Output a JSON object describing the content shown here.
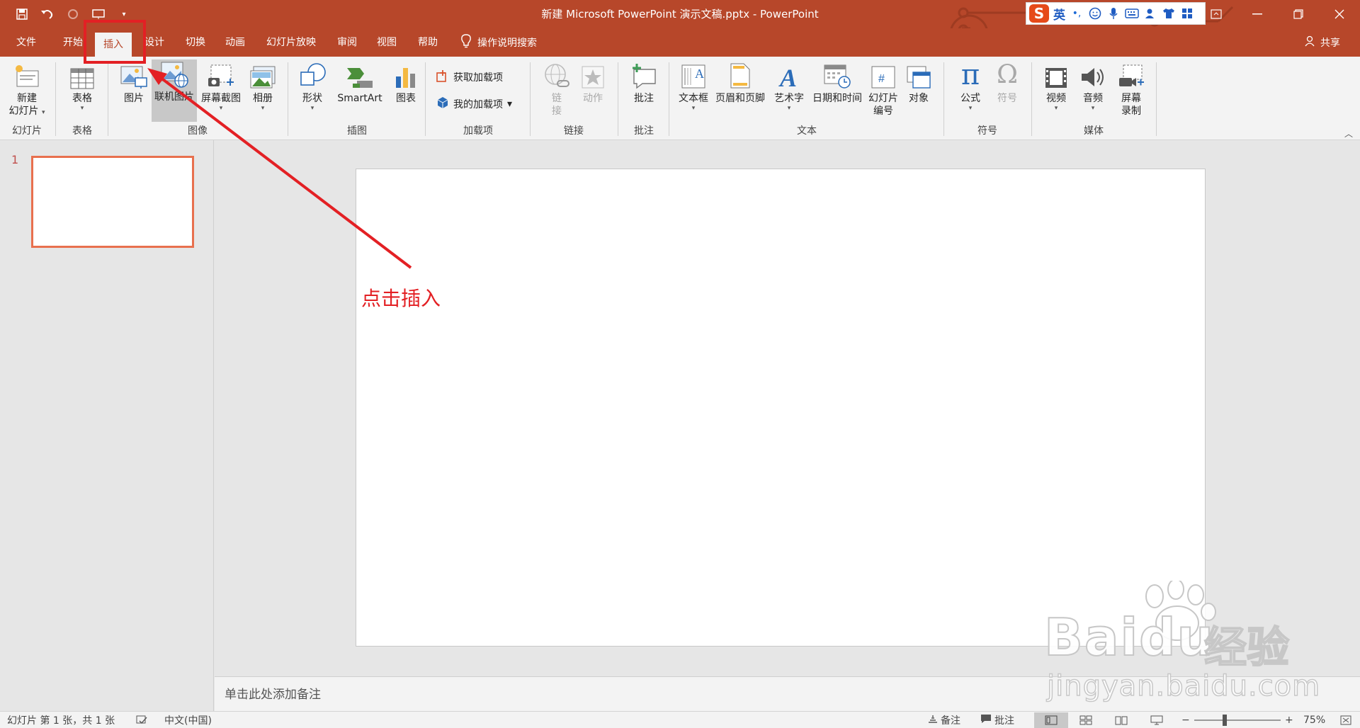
{
  "window": {
    "title": "新建 Microsoft PowerPoint 演示文稿.pptx  -  PowerPoint",
    "accent_color": "#b7472a"
  },
  "ime": {
    "language": "英",
    "punct": "•,"
  },
  "tabs": [
    {
      "label": "文件"
    },
    {
      "label": "开始"
    },
    {
      "label": "插入",
      "active": true
    },
    {
      "label": "设计"
    },
    {
      "label": "切换"
    },
    {
      "label": "动画"
    },
    {
      "label": "幻灯片放映"
    },
    {
      "label": "审阅"
    },
    {
      "label": "视图"
    },
    {
      "label": "帮助"
    }
  ],
  "tell_me": "操作说明搜索",
  "share": "共享",
  "ribbon": {
    "groups": {
      "slides": "幻灯片",
      "tables": "表格",
      "images": "图像",
      "illustrations": "插图",
      "addins": "加载项",
      "links": "链接",
      "comments": "批注",
      "text": "文本",
      "symbols": "符号",
      "media": "媒体"
    },
    "buttons": {
      "new_slide_1": "新建",
      "new_slide_2": "幻灯片",
      "table": "表格",
      "pictures": "图片",
      "online_pictures": "联机图片",
      "screenshot": "屏幕截图",
      "album": "相册",
      "shapes": "形状",
      "smartart": "SmartArt",
      "chart": "图表",
      "get_addins": "获取加载项",
      "my_addins": "我的加载项",
      "link_1": "链",
      "link_2": "接",
      "action": "动作",
      "comment": "批注",
      "textbox": "文本框",
      "header_footer": "页眉和页脚",
      "wordart": "艺术字",
      "datetime": "日期和时间",
      "slide_num_1": "幻灯片",
      "slide_num_2": "编号",
      "object": "对象",
      "equation": "公式",
      "symbol": "符号",
      "video": "视频",
      "audio": "音频",
      "screen_rec_1": "屏幕",
      "screen_rec_2": "录制"
    }
  },
  "thumbnails": {
    "number": "1"
  },
  "notes_placeholder": "单击此处添加备注",
  "annotation": {
    "text": "点击插入",
    "color": "#e32024"
  },
  "watermark": {
    "brand": "Baidu",
    "cn": "经验",
    "url": "jingyan.baidu.com"
  },
  "statusbar": {
    "slide_info": "幻灯片 第 1 张，共 1 张",
    "language": "中文(中国)",
    "notes": "备注",
    "comments": "批注",
    "zoom": "75%"
  }
}
